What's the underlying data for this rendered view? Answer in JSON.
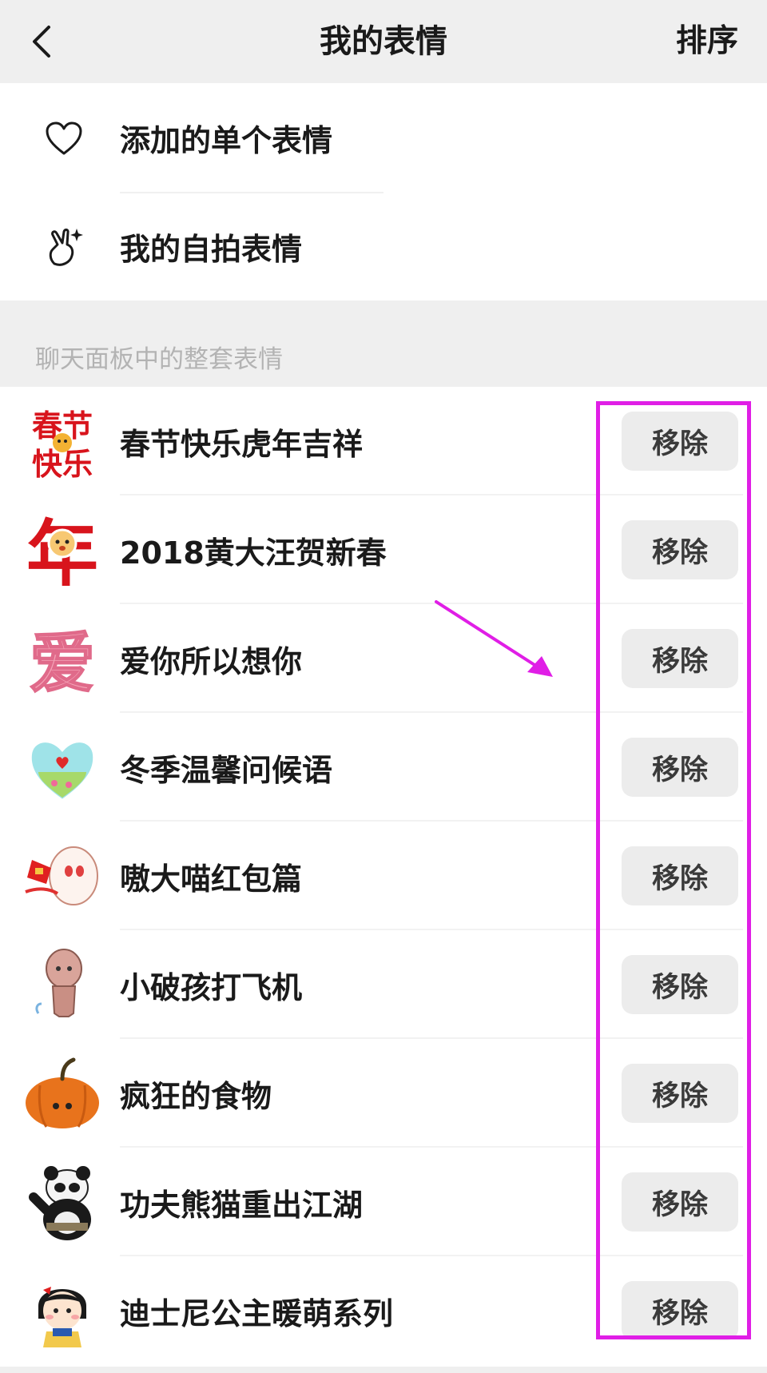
{
  "header": {
    "title": "我的表情",
    "sort_label": "排序",
    "back_icon": "chevron-left-icon"
  },
  "menu": {
    "items": [
      {
        "icon": "heart-icon",
        "label": "添加的单个表情"
      },
      {
        "icon": "selfie-hand-icon",
        "label": "我的自拍表情"
      }
    ]
  },
  "section": {
    "label": "聊天面板中的整套表情"
  },
  "sticker_packs": [
    {
      "name": "春节快乐虎年吉祥",
      "remove_label": "移除"
    },
    {
      "name": "2018黄大汪贺新春",
      "remove_label": "移除"
    },
    {
      "name": "爱你所以想你",
      "remove_label": "移除"
    },
    {
      "name": "冬季温馨问候语",
      "remove_label": "移除"
    },
    {
      "name": "嗷大喵红包篇",
      "remove_label": "移除"
    },
    {
      "name": "小破孩打飞机",
      "remove_label": "移除"
    },
    {
      "name": "疯狂的食物",
      "remove_label": "移除"
    },
    {
      "name": "功夫熊猫重出江湖",
      "remove_label": "移除"
    },
    {
      "name": "迪士尼公主暖萌系列",
      "remove_label": "移除"
    }
  ],
  "thumb_text": {
    "pack0_line1": "春节",
    "pack0_line2": "快乐",
    "pack1": "年",
    "pack2": "爱"
  },
  "colors": {
    "annotation": "#e01ee6",
    "header_bg": "#efefef",
    "button_bg": "#ececec"
  }
}
